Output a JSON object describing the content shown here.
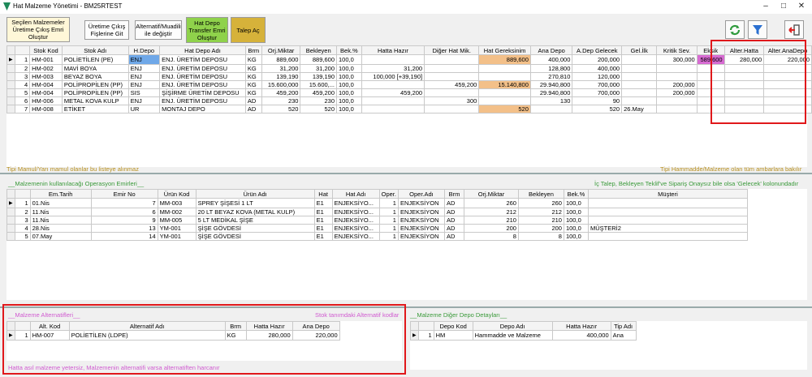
{
  "window": {
    "title": "Hat Malzeme Yönetimi - BM25RTEST"
  },
  "toolbar": {
    "btn1": "Seçilen Malzemeler Üretime Çıkış Emri Oluştur",
    "btn2": "Üretime Çıkış Fişlerine Git",
    "btn3": "Alternatif/Muadili ile değiştir",
    "btn4": "Hat Depo Transfer Emri Oluştur",
    "btn5": "Talep Aç"
  },
  "main_grid": {
    "columns": [
      "",
      "Stok Kod",
      "Stok Adı",
      "H.Depo",
      "Hat Depo Adı",
      "Brm",
      "Orj.Miktar",
      "Bekleyen",
      "Bek.%",
      "Hatta Hazır",
      "Diğer Hat Mik.",
      "Hat Gereksinim",
      "Ana Depo",
      "A.Dep Gelecek",
      "Gel.İlk",
      "Kritik Sev.",
      "Eksik",
      "Alter.Hatta",
      "Alter.AnaDepo"
    ],
    "rows": [
      [
        "1",
        "HM-001",
        "POLİETİLEN (PE)",
        "ENJ",
        "ENJ. ÜRETİM DEPOSU",
        "KG",
        "889,600",
        "889,600",
        "100,0",
        "",
        "",
        "889,600",
        "400,000",
        "200,000",
        "",
        "300,000",
        "589,600",
        "280,000",
        "220,000"
      ],
      [
        "2",
        "HM-002",
        "MAVİ BOYA",
        "ENJ",
        "ENJ. ÜRETİM DEPOSU",
        "KG",
        "31,200",
        "31,200",
        "100,0",
        "31,200",
        "",
        "",
        "128,800",
        "400,000",
        "",
        "",
        "",
        "",
        ""
      ],
      [
        "3",
        "HM-003",
        "BEYAZ BOYA",
        "ENJ",
        "ENJ. ÜRETİM DEPOSU",
        "KG",
        "139,190",
        "139,190",
        "100,0",
        "100,000 [+39,190]",
        "",
        "",
        "270,810",
        "120,000",
        "",
        "",
        "",
        "",
        ""
      ],
      [
        "4",
        "HM-004",
        "POLİPROPİLEN (PP)",
        "ENJ",
        "ENJ. ÜRETİM DEPOSU",
        "KG",
        "15.600,000",
        "15.600,...",
        "100,0",
        "",
        "459,200",
        "15.140,800",
        "29.940,800",
        "700,000",
        "",
        "200,000",
        "",
        "",
        ""
      ],
      [
        "5",
        "HM-004",
        "POLİPROPİLEN (PP)",
        "SIS",
        "ŞİŞİRME ÜRETİM DEPOSU",
        "KG",
        "459,200",
        "459,200",
        "100,0",
        "459,200",
        "",
        "",
        "29.940,800",
        "700,000",
        "",
        "200,000",
        "",
        "",
        ""
      ],
      [
        "6",
        "HM-006",
        "METAL KOVA KULP",
        "ENJ",
        "ENJ. ÜRETİM DEPOSU",
        "AD",
        "230",
        "230",
        "100,0",
        "",
        "300",
        "",
        "130",
        "90",
        "",
        "",
        "",
        "",
        ""
      ],
      [
        "7",
        "HM-008",
        "ETİKET",
        "UR",
        "MONTAJ DEPO",
        "AD",
        "520",
        "520",
        "100,0",
        "",
        "",
        "520",
        "",
        "520",
        "26.May",
        "",
        "",
        "",
        ""
      ]
    ],
    "hint_left": "Tipi Mamul/Yarı mamul olanlar bu listeye alınmaz",
    "hint_right": "Tipi Hammadde/Malzeme olan tüm ambarlara bakılır"
  },
  "orders": {
    "title": "__Malzemenin kullanılacağı Operasyon Emirleri__",
    "hint": "İç Talep, Bekleyen Teklif've Sipariş Onaysız bile olsa 'Gelecek' kolonundadır",
    "columns": [
      "",
      "Em.Tarih",
      "Emir No",
      "Ürün Kod",
      "Ürün Adı",
      "Hat",
      "Hat Adı",
      "Oper.",
      "Oper.Adı",
      "Brm",
      "Orj.Miktar",
      "Bekleyen",
      "Bek.%",
      "Müşteri"
    ],
    "rows": [
      [
        "1",
        "01.Nis",
        "7",
        "MM-003",
        "SPREY ŞİŞESİ 1 LT",
        "E1",
        "ENJEKSİYO...",
        "1",
        "ENJEKSİYON",
        "AD",
        "260",
        "260",
        "100,0",
        ""
      ],
      [
        "2",
        "11.Nis",
        "6",
        "MM-002",
        "20 LT BEYAZ KOVA (METAL KULP)",
        "E1",
        "ENJEKSİYO...",
        "1",
        "ENJEKSİYON",
        "AD",
        "212",
        "212",
        "100,0",
        ""
      ],
      [
        "3",
        "11.Nis",
        "9",
        "MM-005",
        "5 LT MEDİKAL ŞİŞE",
        "E1",
        "ENJEKSİYO...",
        "1",
        "ENJEKSİYON",
        "AD",
        "210",
        "210",
        "100,0",
        ""
      ],
      [
        "4",
        "28.Nis",
        "13",
        "YM-001",
        "ŞİŞE GÖVDESİ",
        "E1",
        "ENJEKSİYO...",
        "1",
        "ENJEKSİYON",
        "AD",
        "200",
        "200",
        "100,0",
        "MÜŞTERİ2"
      ],
      [
        "5",
        "07.May",
        "14",
        "YM-001",
        "ŞİŞE GÖVDESİ",
        "E1",
        "ENJEKSİYO...",
        "1",
        "ENJEKSİYON",
        "AD",
        "8",
        "8",
        "100,0",
        ""
      ]
    ]
  },
  "alternatives": {
    "title": "__Malzeme Alternatifleri__",
    "hint_top": "Stok tanımdaki Alternatif kodlar",
    "hint_bottom": "Hatta asıl malzeme yetersiz, Malzemenin alternatifi varsa alternatiften harcanır",
    "columns": [
      "",
      "Alt. Kod",
      "Alternatif Adı",
      "Brm",
      "Hatta Hazır",
      "Ana Depo"
    ],
    "rows": [
      [
        "1",
        "HM-007",
        "POLİETİLEN (LDPE)",
        "KG",
        "280,000",
        "220,000"
      ]
    ]
  },
  "other_depots": {
    "title": "__Malzeme Diğer Depo Detayları__",
    "columns": [
      "",
      "Depo Kod",
      "Depo Adı",
      "Hatta Hazır",
      "Tip Adı"
    ],
    "rows": [
      [
        "1",
        "HM",
        "Hammadde ve Malzeme",
        "400,000",
        "Ana"
      ]
    ]
  },
  "colors": {
    "orange": "#f3c089",
    "blue": "#6fa8e8",
    "magenta": "#d76bd2",
    "highlight_box": "#e0181b",
    "hint_green": "#3a9a3a",
    "hint_pink": "#d05ad0"
  },
  "icons": [
    "refresh-icon",
    "filter-icon",
    "exit-icon",
    "app-logo-icon"
  ]
}
